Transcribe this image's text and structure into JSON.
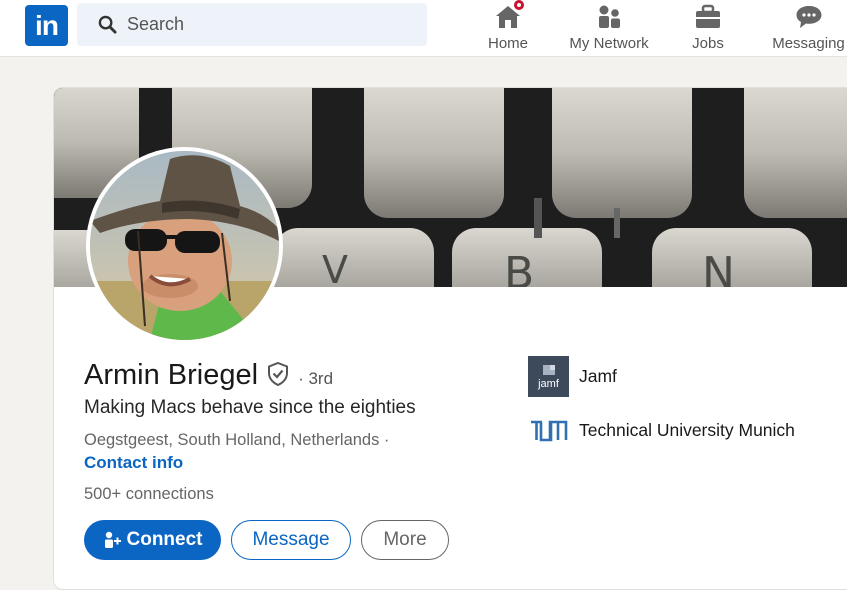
{
  "topnav": {
    "logo_text": "in",
    "search_placeholder": "Search",
    "items": [
      {
        "label": "Home",
        "icon": "home-icon",
        "has_notification": true
      },
      {
        "label": "My Network",
        "icon": "people-icon"
      },
      {
        "label": "Jobs",
        "icon": "briefcase-icon"
      },
      {
        "label": "Messaging",
        "icon": "chat-icon"
      }
    ]
  },
  "profile": {
    "name": "Armin Briegel",
    "verified_icon": "shield-check-icon",
    "degree": "· 3rd",
    "headline": "Making Macs behave since the eighties",
    "location": "Oegstgeest, South Holland, Netherlands ·",
    "contact_info": "Contact info",
    "connections": "500+",
    "connections_suffix": " connections",
    "cover_image": "typewriter-keys-photo",
    "avatar_image": "man-in-hat-with-sunglasses-photo"
  },
  "actions": {
    "connect": "Connect",
    "message": "Message",
    "more": "More"
  },
  "organizations": [
    {
      "name": "Jamf",
      "logo_text": "jamf",
      "logo_icon": "jamf-logo"
    },
    {
      "name": "Technical University Munich",
      "logo_icon": "tum-logo"
    }
  ],
  "colors": {
    "brand": "#0a66c2",
    "background": "#f4f2ee",
    "notification": "#cb112d"
  }
}
